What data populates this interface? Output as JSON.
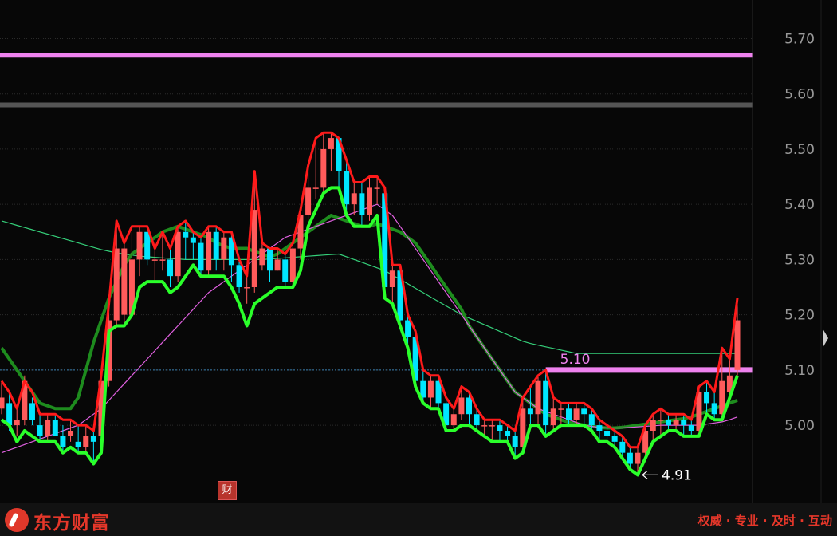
{
  "chart_data": {
    "type": "candlestick",
    "ylim": [
      4.86,
      5.77
    ],
    "y_ticks": [
      5.0,
      5.1,
      5.2,
      5.3,
      5.4,
      5.5,
      5.6,
      5.7
    ],
    "y_tick_labels": [
      "5.00",
      "5.10",
      "5.20",
      "5.30",
      "5.40",
      "5.50",
      "5.60",
      "5.70"
    ],
    "current_price": 5.1,
    "high_level": 5.67,
    "upper_level": 5.58,
    "support_line": {
      "value": 5.1,
      "label": "5.10"
    },
    "low_annotation": {
      "value": 4.91,
      "label": "4.91"
    },
    "colors": {
      "up": "#ff5b5b",
      "down": "#00e6ff",
      "upper_band": "#ff1a1a",
      "lower_band": "#2aff2a",
      "ma_dark": "#1e8c1e",
      "ma_light": "#35d07a",
      "ma_pink": "#e060e0",
      "level": "#ee82ee"
    },
    "candles": [
      [
        5.03,
        5.05,
        5.08,
        5.02
      ],
      [
        5.04,
        5.0,
        5.06,
        4.99
      ],
      [
        5.0,
        5.01,
        5.03,
        4.98
      ],
      [
        5.01,
        5.08,
        5.09,
        5.0
      ],
      [
        5.04,
        5.01,
        5.05,
        5.0
      ],
      [
        5.0,
        4.98,
        5.02,
        4.97
      ],
      [
        4.98,
        5.01,
        5.02,
        4.97
      ],
      [
        5.01,
        4.98,
        5.02,
        4.98
      ],
      [
        4.98,
        4.96,
        5.0,
        4.95
      ],
      [
        4.98,
        4.99,
        5.01,
        4.97
      ],
      [
        4.97,
        4.96,
        5.0,
        4.95
      ],
      [
        4.96,
        4.98,
        5.0,
        4.95
      ],
      [
        4.98,
        4.97,
        4.99,
        4.93
      ],
      [
        4.98,
        5.08,
        5.09,
        4.97
      ],
      [
        5.08,
        5.19,
        5.22,
        5.07
      ],
      [
        5.19,
        5.32,
        5.37,
        5.18
      ],
      [
        5.2,
        5.32,
        5.33,
        5.18
      ],
      [
        5.2,
        5.3,
        5.36,
        5.19
      ],
      [
        5.3,
        5.35,
        5.36,
        5.27
      ],
      [
        5.35,
        5.3,
        5.36,
        5.29
      ],
      [
        5.3,
        5.3,
        5.32,
        5.26
      ],
      [
        5.3,
        5.3,
        5.35,
        5.28
      ],
      [
        5.3,
        5.27,
        5.32,
        5.25
      ],
      [
        5.27,
        5.35,
        5.36,
        5.26
      ],
      [
        5.35,
        5.34,
        5.37,
        5.3
      ],
      [
        5.34,
        5.33,
        5.35,
        5.3
      ],
      [
        5.33,
        5.28,
        5.34,
        5.27
      ],
      [
        5.28,
        5.35,
        5.36,
        5.27
      ],
      [
        5.35,
        5.3,
        5.36,
        5.28
      ],
      [
        5.3,
        5.34,
        5.35,
        5.28
      ],
      [
        5.34,
        5.29,
        5.35,
        5.26
      ],
      [
        5.29,
        5.25,
        5.3,
        5.24
      ],
      [
        5.25,
        5.25,
        5.27,
        5.22
      ],
      [
        5.25,
        5.39,
        5.46,
        5.24
      ],
      [
        5.29,
        5.32,
        5.33,
        5.28
      ],
      [
        5.32,
        5.28,
        5.32,
        5.26
      ],
      [
        5.28,
        5.3,
        5.32,
        5.28
      ],
      [
        5.3,
        5.26,
        5.31,
        5.25
      ],
      [
        5.26,
        5.32,
        5.33,
        5.25
      ],
      [
        5.32,
        5.38,
        5.39,
        5.3
      ],
      [
        5.38,
        5.43,
        5.47,
        5.36
      ],
      [
        5.43,
        5.43,
        5.52,
        5.41
      ],
      [
        5.43,
        5.5,
        5.53,
        5.42
      ],
      [
        5.5,
        5.52,
        5.53,
        5.46
      ],
      [
        5.52,
        5.46,
        5.52,
        5.43
      ],
      [
        5.46,
        5.4,
        5.48,
        5.38
      ],
      [
        5.4,
        5.42,
        5.44,
        5.38
      ],
      [
        5.42,
        5.38,
        5.44,
        5.36
      ],
      [
        5.38,
        5.43,
        5.45,
        5.37
      ],
      [
        5.43,
        5.43,
        5.45,
        5.4
      ],
      [
        5.42,
        5.25,
        5.43,
        5.23
      ],
      [
        5.25,
        5.28,
        5.29,
        5.22
      ],
      [
        5.28,
        5.19,
        5.29,
        5.18
      ],
      [
        5.19,
        5.16,
        5.2,
        5.14
      ],
      [
        5.16,
        5.08,
        5.17,
        5.07
      ],
      [
        5.08,
        5.05,
        5.1,
        5.04
      ],
      [
        5.05,
        5.08,
        5.09,
        5.03
      ],
      [
        5.08,
        5.04,
        5.09,
        5.03
      ],
      [
        5.04,
        5.0,
        5.05,
        4.99
      ],
      [
        5.0,
        5.02,
        5.03,
        4.99
      ],
      [
        5.02,
        5.05,
        5.07,
        5.01
      ],
      [
        5.05,
        5.02,
        5.06,
        5.0
      ],
      [
        5.02,
        5.0,
        5.03,
        4.99
      ],
      [
        5.0,
        5.0,
        5.01,
        4.98
      ],
      [
        5.0,
        5.0,
        5.01,
        4.97
      ],
      [
        5.0,
        4.99,
        5.01,
        4.97
      ],
      [
        4.99,
        4.98,
        5.0,
        4.97
      ],
      [
        4.98,
        4.96,
        4.99,
        4.94
      ],
      [
        4.96,
        5.03,
        5.05,
        4.95
      ],
      [
        5.03,
        5.02,
        5.07,
        5.0
      ],
      [
        5.02,
        5.08,
        5.09,
        5.0
      ],
      [
        5.08,
        5.0,
        5.1,
        4.98
      ],
      [
        5.0,
        5.03,
        5.05,
        4.99
      ],
      [
        5.03,
        5.03,
        5.04,
        5.0
      ],
      [
        5.03,
        5.01,
        5.04,
        5.0
      ],
      [
        5.01,
        5.03,
        5.04,
        5.0
      ],
      [
        5.03,
        5.02,
        5.04,
        5.0
      ],
      [
        5.02,
        5.0,
        5.03,
        4.99
      ],
      [
        5.0,
        4.99,
        5.01,
        4.97
      ],
      [
        4.99,
        4.98,
        5.0,
        4.97
      ],
      [
        4.98,
        4.97,
        4.99,
        4.96
      ],
      [
        4.97,
        4.95,
        4.98,
        4.94
      ],
      [
        4.95,
        4.93,
        4.96,
        4.92
      ],
      [
        4.93,
        4.95,
        4.96,
        4.91
      ],
      [
        4.95,
        4.99,
        5.0,
        4.94
      ],
      [
        4.99,
        5.01,
        5.02,
        4.97
      ],
      [
        5.01,
        5.01,
        5.03,
        4.98
      ],
      [
        5.01,
        5.0,
        5.02,
        4.99
      ],
      [
        5.0,
        5.01,
        5.02,
        4.99
      ],
      [
        5.01,
        5.0,
        5.02,
        4.98
      ],
      [
        5.0,
        4.99,
        5.01,
        4.98
      ],
      [
        4.99,
        5.06,
        5.07,
        4.98
      ],
      [
        5.06,
        5.04,
        5.08,
        5.02
      ],
      [
        5.04,
        5.02,
        5.06,
        5.01
      ],
      [
        5.02,
        5.08,
        5.14,
        5.01
      ],
      [
        5.06,
        5.09,
        5.12,
        5.05
      ],
      [
        5.1,
        5.19,
        5.23,
        5.09
      ]
    ],
    "upper_band": [
      5.08,
      5.06,
      5.03,
      5.08,
      5.06,
      5.02,
      5.02,
      5.02,
      5.01,
      5.01,
      5.0,
      5.0,
      4.99,
      5.09,
      5.22,
      5.37,
      5.33,
      5.36,
      5.36,
      5.36,
      5.32,
      5.35,
      5.32,
      5.36,
      5.37,
      5.35,
      5.34,
      5.36,
      5.36,
      5.35,
      5.35,
      5.3,
      5.27,
      5.46,
      5.33,
      5.32,
      5.32,
      5.31,
      5.33,
      5.39,
      5.47,
      5.52,
      5.53,
      5.53,
      5.52,
      5.48,
      5.44,
      5.44,
      5.45,
      5.45,
      5.43,
      5.29,
      5.29,
      5.2,
      5.17,
      5.1,
      5.09,
      5.09,
      5.05,
      5.03,
      5.07,
      5.06,
      5.03,
      5.01,
      5.01,
      5.01,
      5.0,
      4.99,
      5.05,
      5.07,
      5.09,
      5.1,
      5.05,
      5.04,
      5.04,
      5.04,
      5.04,
      5.03,
      5.01,
      5.0,
      4.99,
      4.98,
      4.96,
      4.96,
      5.0,
      5.02,
      5.03,
      5.02,
      5.02,
      5.02,
      5.01,
      5.07,
      5.08,
      5.06,
      5.14,
      5.12,
      5.23
    ],
    "lower_band": [
      5.01,
      5.0,
      4.97,
      4.99,
      4.98,
      4.97,
      4.97,
      4.97,
      4.95,
      4.96,
      4.95,
      4.95,
      4.93,
      4.95,
      5.17,
      5.18,
      5.18,
      5.2,
      5.25,
      5.26,
      5.26,
      5.26,
      5.24,
      5.25,
      5.27,
      5.29,
      5.27,
      5.27,
      5.27,
      5.27,
      5.25,
      5.22,
      5.18,
      5.22,
      5.23,
      5.24,
      5.25,
      5.25,
      5.25,
      5.28,
      5.36,
      5.39,
      5.42,
      5.43,
      5.43,
      5.38,
      5.36,
      5.36,
      5.36,
      5.38,
      5.23,
      5.22,
      5.18,
      5.14,
      5.07,
      5.04,
      5.03,
      5.03,
      4.99,
      4.99,
      5.0,
      5.0,
      4.99,
      4.98,
      4.97,
      4.97,
      4.97,
      4.94,
      4.95,
      5.0,
      5.0,
      4.98,
      4.99,
      5.0,
      5.0,
      5.0,
      5.0,
      4.99,
      4.97,
      4.97,
      4.96,
      4.94,
      4.92,
      4.91,
      4.94,
      4.97,
      4.98,
      4.99,
      4.99,
      4.98,
      4.98,
      4.98,
      5.02,
      5.01,
      5.01,
      5.05,
      5.09
    ],
    "ma_dark": [
      5.14,
      5.12,
      5.1,
      5.08,
      5.06,
      5.04,
      5.035,
      5.03,
      5.03,
      5.03,
      5.05,
      5.1,
      5.15,
      5.19,
      5.23,
      5.26,
      5.29,
      5.31,
      5.32,
      5.33,
      5.34,
      5.35,
      5.355,
      5.36,
      5.355,
      5.35,
      5.345,
      5.34,
      5.33,
      5.325,
      5.32,
      5.32,
      5.32,
      5.315,
      5.31,
      5.305,
      5.31,
      5.32,
      5.33,
      5.34,
      5.35,
      5.36,
      5.37,
      5.38,
      5.375,
      5.37,
      5.365,
      5.36,
      5.36,
      5.365,
      5.36,
      5.355,
      5.35,
      5.34,
      5.33,
      5.31,
      5.29,
      5.27,
      5.25,
      5.23,
      5.21,
      5.18,
      5.16,
      5.14,
      5.12,
      5.1,
      5.08,
      5.06,
      5.05,
      5.04,
      5.03,
      5.02,
      5.015,
      5.01,
      5.005,
      5.003,
      5.0,
      4.998,
      4.996,
      4.995,
      4.995,
      4.996,
      4.998,
      5.0,
      5.002,
      5.004,
      5.006,
      5.008,
      5.01,
      5.012,
      5.015,
      5.02,
      5.025,
      5.03,
      5.035,
      5.04,
      5.045
    ],
    "ma_light": [
      5.37,
      5.366,
      5.362,
      5.358,
      5.354,
      5.35,
      5.346,
      5.342,
      5.338,
      5.334,
      5.33,
      5.326,
      5.322,
      5.318,
      5.315,
      5.312,
      5.31,
      5.308,
      5.306,
      5.305,
      5.304,
      5.303,
      5.302,
      5.301,
      5.3,
      5.3,
      5.3,
      5.3,
      5.3,
      5.3,
      5.3,
      5.3,
      5.3,
      5.3,
      5.3,
      5.301,
      5.302,
      5.303,
      5.304,
      5.305,
      5.306,
      5.307,
      5.308,
      5.309,
      5.31,
      5.305,
      5.3,
      5.295,
      5.29,
      5.285,
      5.28,
      5.272,
      5.264,
      5.256,
      5.248,
      5.24,
      5.232,
      5.224,
      5.216,
      5.208,
      5.2,
      5.194,
      5.188,
      5.182,
      5.176,
      5.17,
      5.164,
      5.158,
      5.152,
      5.148,
      5.145,
      5.142,
      5.139,
      5.136,
      5.133,
      5.13,
      5.13,
      5.13,
      5.13,
      5.13,
      5.13,
      5.13,
      5.13,
      5.13,
      5.13,
      5.13,
      5.13,
      5.13,
      5.13,
      5.13,
      5.13,
      5.13,
      5.13,
      5.13,
      5.13,
      5.13,
      5.13
    ],
    "ma_pink": [
      4.95,
      4.955,
      4.96,
      4.965,
      4.97,
      4.975,
      4.98,
      4.985,
      4.99,
      4.995,
      5.0,
      5.01,
      5.02,
      5.03,
      5.045,
      5.06,
      5.075,
      5.09,
      5.105,
      5.12,
      5.135,
      5.15,
      5.165,
      5.18,
      5.195,
      5.21,
      5.225,
      5.24,
      5.25,
      5.26,
      5.27,
      5.28,
      5.29,
      5.3,
      5.31,
      5.32,
      5.33,
      5.34,
      5.345,
      5.35,
      5.355,
      5.36,
      5.365,
      5.37,
      5.375,
      5.38,
      5.385,
      5.39,
      5.395,
      5.4,
      5.39,
      5.38,
      5.36,
      5.34,
      5.32,
      5.3,
      5.28,
      5.26,
      5.24,
      5.22,
      5.2,
      5.18,
      5.16,
      5.14,
      5.12,
      5.1,
      5.08,
      5.06,
      5.05,
      5.04,
      5.03,
      5.025,
      5.02,
      5.015,
      5.01,
      5.005,
      5.0,
      4.998,
      4.996,
      4.995,
      4.995,
      4.995,
      4.996,
      4.997,
      4.998,
      4.999,
      5.0,
      5.0,
      5.0,
      5.0,
      5.0,
      5.0,
      5.002,
      5.004,
      5.006,
      5.01,
      5.015
    ]
  },
  "badge": {
    "label": "财"
  },
  "footer": {
    "brand": "东方财富",
    "slogan": "权威 · 专业 · 及时 · 互动"
  }
}
